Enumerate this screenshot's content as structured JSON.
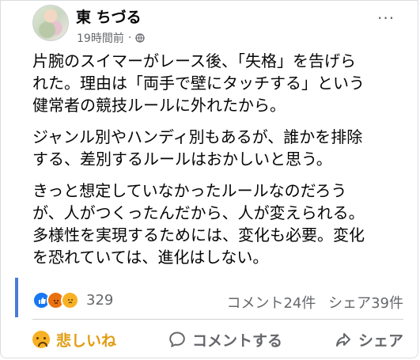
{
  "post": {
    "author": "東 ちづる",
    "time": "19時間前",
    "separator": "·",
    "paragraphs": [
      "片腕のスイマーがレース後、「失格」を告げら\nれた。理由は「両手で壁にタッチする」という\n健常者の競技ルールに外れたから。",
      "ジャンル別やハンディ別もあるが、誰かを排除\nする、差別するルールはおかしいと思う。",
      "きっと想定していなかったルールなのだろう\nが、人がつくったんだから、人が変えられる。\n多様性を実現するためには、変化も必要。変化\nを恐れていては、進化はしない。"
    ]
  },
  "reactions": {
    "count": "329",
    "comments": "コメント24件",
    "shares": "シェア39件"
  },
  "actions": {
    "reaction": "悲しいね",
    "comment": "コメントする",
    "share": "シェア"
  },
  "more_glyph": "···",
  "colors": {
    "facebook_blue": "#1877f2",
    "muted": "#65676b",
    "sad": "#e29c10"
  }
}
